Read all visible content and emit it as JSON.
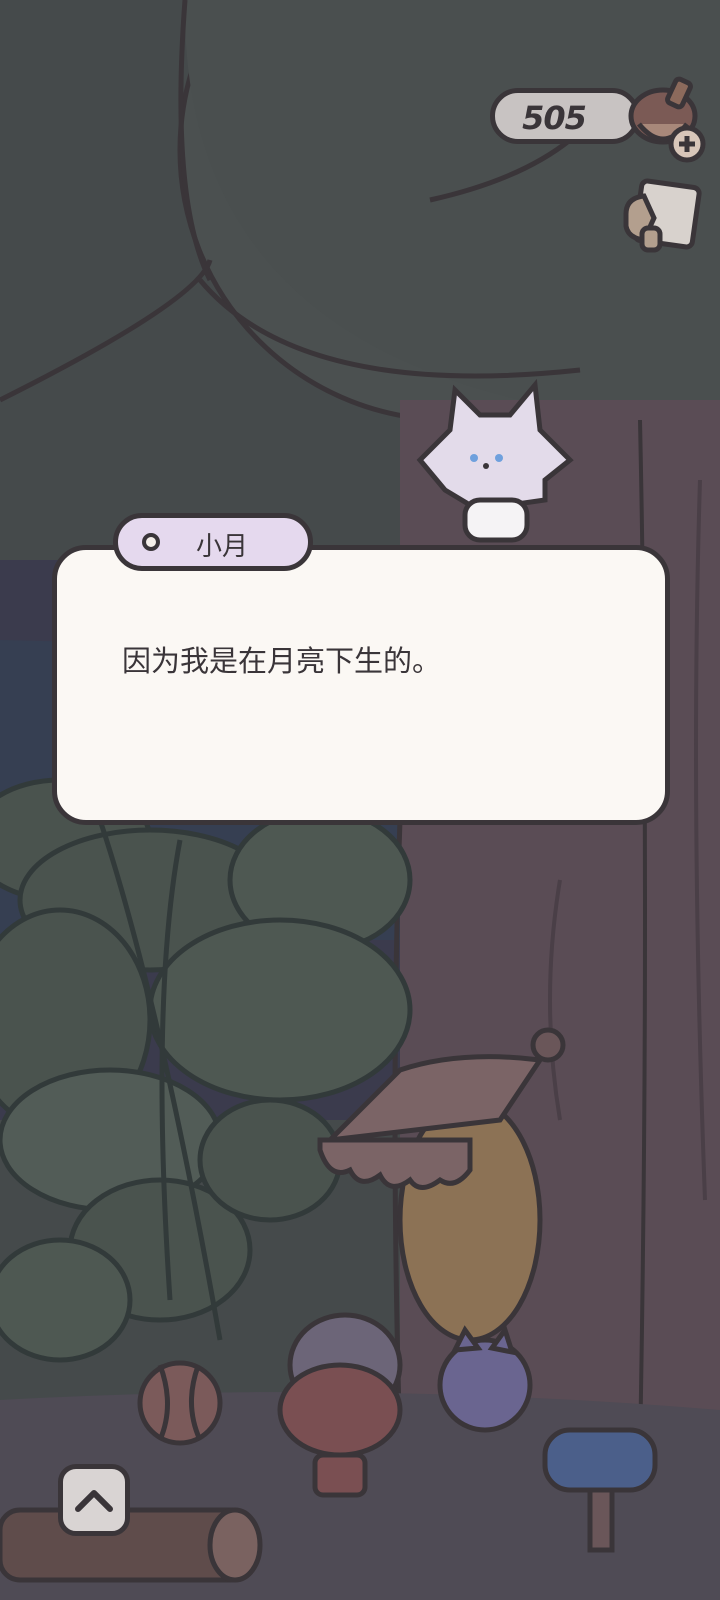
{
  "hud": {
    "currency_amount": "505",
    "currency_icon": "acorn-icon",
    "currency_add_icon": "plus-icon",
    "note_icon": "note-icon"
  },
  "dialog": {
    "speaker": "小月",
    "text": "因为我是在月亮下生的。"
  },
  "controls": {
    "expand_icon": "chevron-up-icon"
  },
  "colors": {
    "outline": "#3a3539",
    "dialog_bg": "#fbf8f4",
    "name_tab_bg": "#e5d9ee",
    "currency_bg": "#c8c3c2",
    "canopy": "#454a4b",
    "trunk": "#5a4c55"
  }
}
